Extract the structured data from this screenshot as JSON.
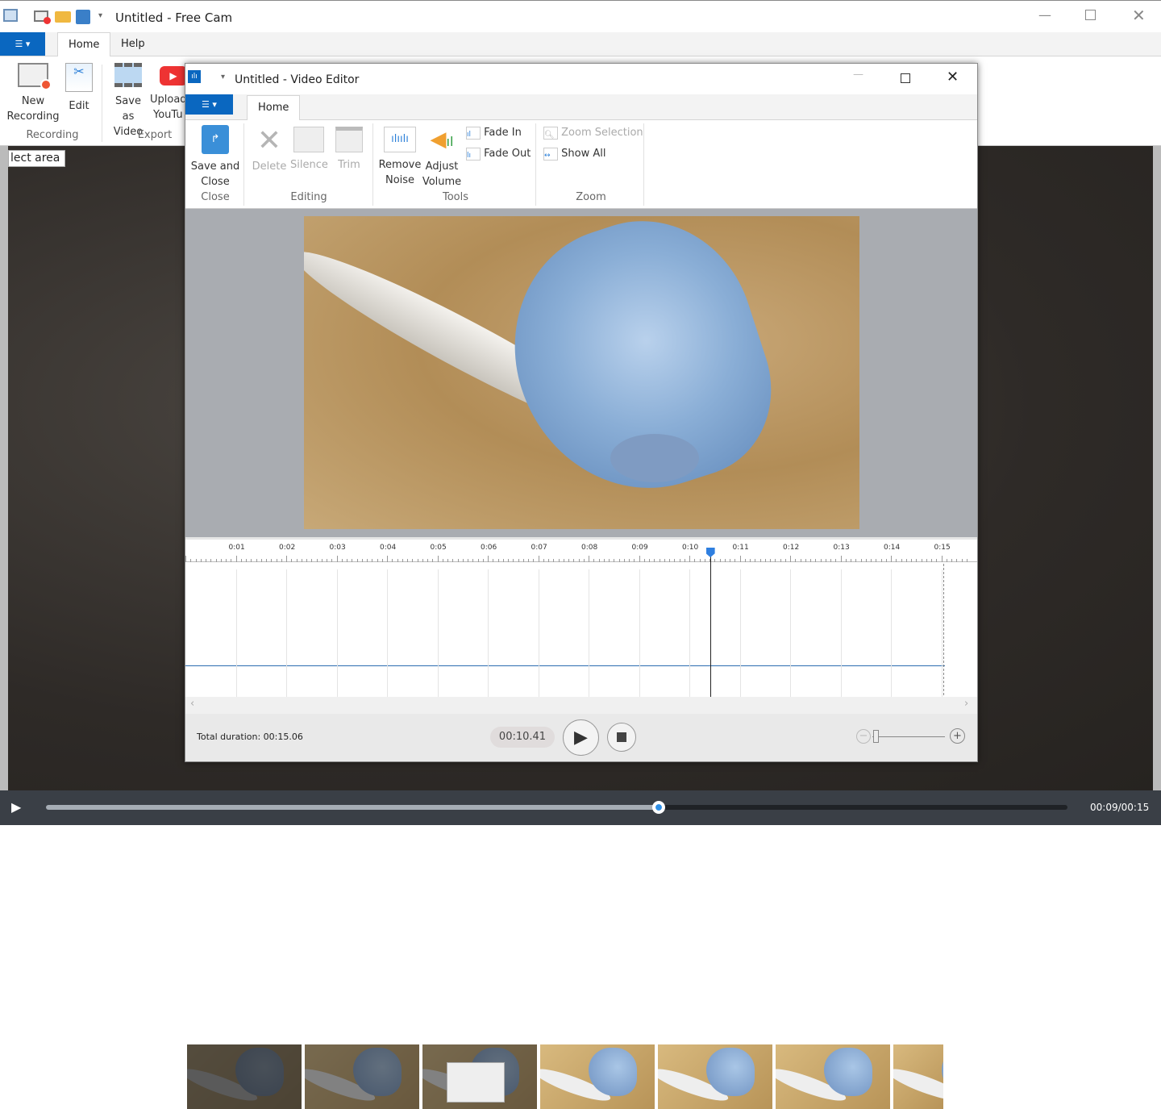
{
  "main_window": {
    "title": "Untitled - Free Cam",
    "tabs": [
      {
        "label": "Home",
        "active": true
      },
      {
        "label": "Help",
        "active": false
      }
    ],
    "ribbon": {
      "buttons": [
        {
          "label1": "New",
          "label2": "Recording",
          "icon": "new-recording-icon"
        },
        {
          "label1": "Edit",
          "label2": "",
          "icon": "edit-icon"
        },
        {
          "label1": "Save as",
          "label2": "Video",
          "icon": "film-icon"
        },
        {
          "label1": "Upload",
          "label2": "YouTu",
          "icon": "youtube-icon"
        }
      ],
      "groups": [
        "Recording",
        "Export"
      ]
    },
    "select_area_label": "lect area",
    "player": {
      "time": "00:09/00:15",
      "progress": 0.6
    }
  },
  "editor": {
    "title": "Untitled - Video Editor",
    "tabs": [
      {
        "label": "Home",
        "active": true
      }
    ],
    "ribbon": {
      "save_close": {
        "label1": "Save and",
        "label2": "Close"
      },
      "delete": "Delete",
      "silence": "Silence",
      "trim": "Trim",
      "remove_noise": {
        "label1": "Remove",
        "label2": "Noise"
      },
      "adjust_volume": {
        "label1": "Adjust",
        "label2": "Volume"
      },
      "fade_in": "Fade In",
      "fade_out": "Fade Out",
      "zoom_selection": "Zoom Selection",
      "show_all": "Show All",
      "groups": {
        "close": "Close",
        "editing": "Editing",
        "tools": "Tools",
        "zoom": "Zoom"
      }
    },
    "timeline": {
      "ticks": [
        "0:01",
        "0:02",
        "0:03",
        "0:04",
        "0:05",
        "0:06",
        "0:07",
        "0:08",
        "0:09",
        "0:10",
        "0:11",
        "0:12",
        "0:13",
        "0:14",
        "0:15"
      ],
      "playhead_seconds": 10.41,
      "duration_seconds": 15.06
    },
    "footer": {
      "total_duration": "Total duration: 00:15.06",
      "current_time": "00:10.41"
    }
  },
  "colors": {
    "accent": "#0a67c0",
    "playhead": "#2f7fe0"
  }
}
